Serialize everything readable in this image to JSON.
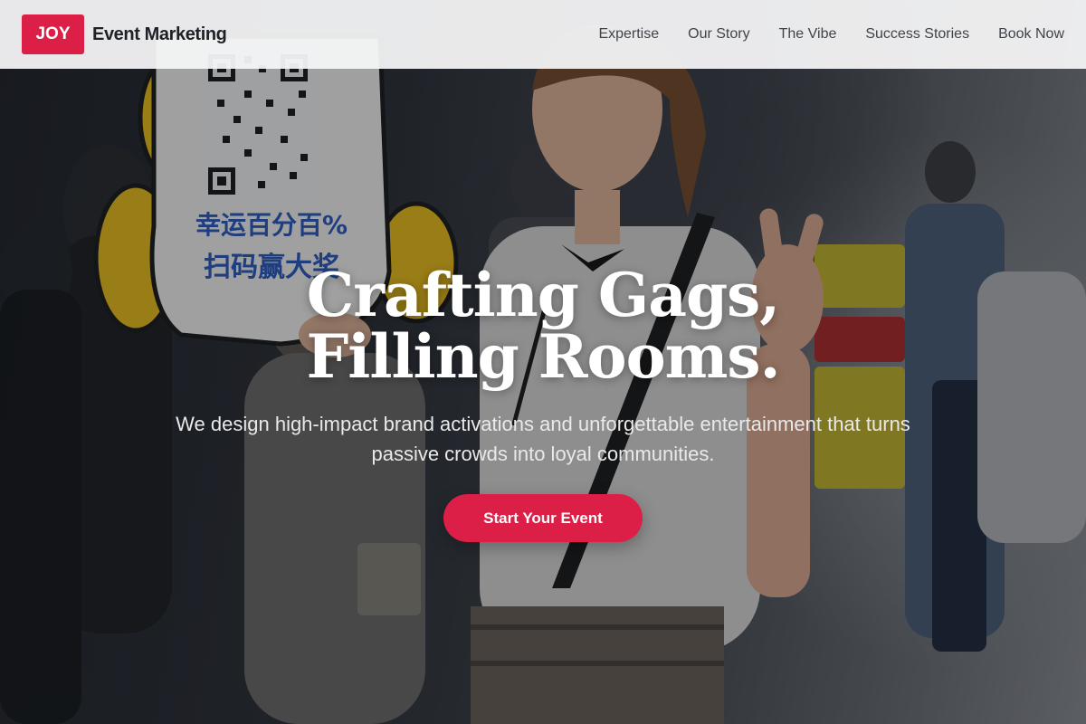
{
  "nav": {
    "brand_badge": "JOY",
    "brand_name": "Event Marketing",
    "links": [
      "Expertise",
      "Our Story",
      "The Vibe",
      "Success Stories",
      "Book Now"
    ]
  },
  "hero": {
    "headline_line1": "Crafting Gags,",
    "headline_line2": "Filling Rooms.",
    "subtitle": "We design high-impact brand activations and unforgettable entertainment that turns passive crowds into loyal communities.",
    "cta_label": "Start Your Event",
    "sign_text_1": "幸运百分百%",
    "sign_text_2": "扫码赢大奖"
  },
  "colors": {
    "accent": "#dc1f47",
    "nav_bg": "#f5f5f6",
    "text_dark": "#1e2226"
  },
  "icons": [
    "qr-code-icon"
  ]
}
